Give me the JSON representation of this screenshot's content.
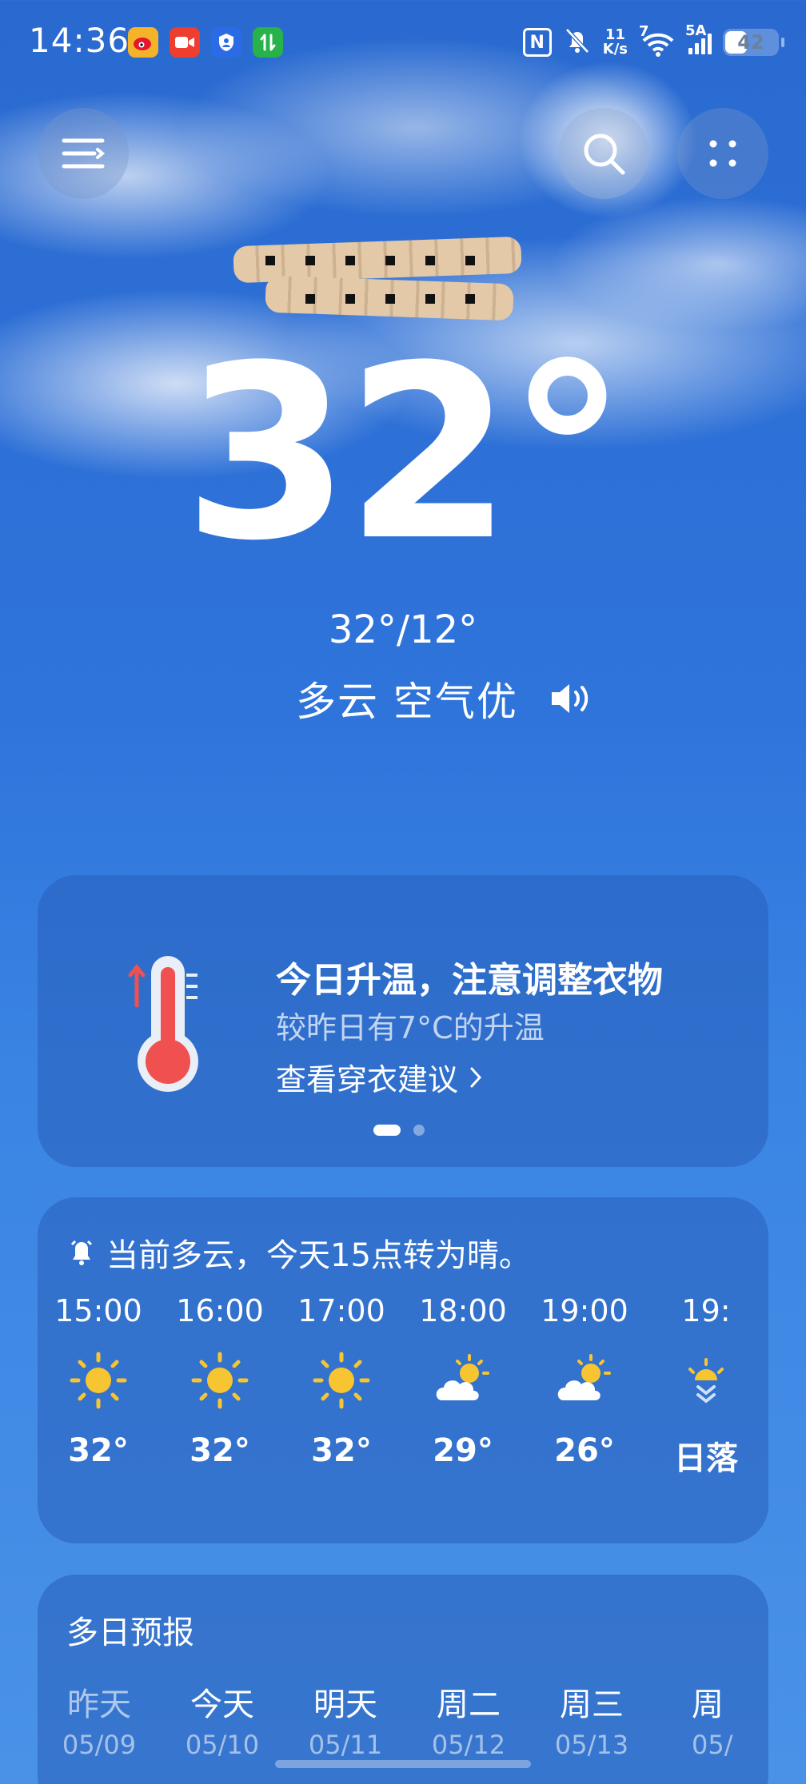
{
  "status_bar": {
    "time": "14:36",
    "net_speed_value": "11",
    "net_speed_unit": "K/s",
    "wifi_label": "7",
    "signal_label": "5A",
    "battery": "42",
    "battery_level": 0.42
  },
  "location": "",
  "current": {
    "temperature": "32°",
    "range": "32°/12°",
    "condition": "多云 空气优"
  },
  "tip_card": {
    "title": "今日升温，注意调整衣物",
    "subtitle": "较昨日有7°C的升温",
    "link": "查看穿衣建议"
  },
  "hourly": {
    "alert": "当前多云，今天15点转为晴。",
    "hours": [
      {
        "time": "15:00",
        "icon": "sun-icon",
        "temp": "32°"
      },
      {
        "time": "16:00",
        "icon": "sun-icon",
        "temp": "32°"
      },
      {
        "time": "17:00",
        "icon": "sun-icon",
        "temp": "32°"
      },
      {
        "time": "18:00",
        "icon": "partly-cloudy-icon",
        "temp": "29°"
      },
      {
        "time": "19:00",
        "icon": "partly-cloudy-icon",
        "temp": "26°"
      },
      {
        "time": "19:",
        "icon": "sunset-icon",
        "temp": "日落"
      }
    ]
  },
  "multi_day": {
    "title": "多日预报",
    "days": [
      {
        "name": "昨天",
        "date": "05/09"
      },
      {
        "name": "今天",
        "date": "05/10"
      },
      {
        "name": "明天",
        "date": "05/11"
      },
      {
        "name": "周二",
        "date": "05/12"
      },
      {
        "name": "周三",
        "date": "05/13"
      },
      {
        "name": "周",
        "date": "05/"
      }
    ]
  },
  "colors": {
    "sun": "#F7C531",
    "thermometer_red": "#F0504F"
  }
}
